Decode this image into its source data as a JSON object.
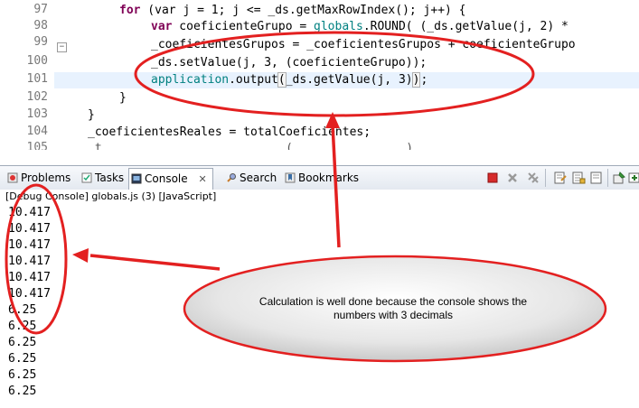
{
  "editor": {
    "line_numbers": [
      "97",
      "98",
      "99",
      "100",
      "101",
      "102",
      "103",
      "104",
      "105"
    ],
    "lines": [
      {
        "kw": "for",
        "rest": " (var j = 1; j <= _ds.getMaxRowIndex(); j++) {"
      },
      {
        "kw": "var",
        "pre": " coeficienteGrupo = ",
        "glob": "globals",
        "post": ".ROUND( (_ds.getValue(j, 2) * "
      },
      {
        "text": "_coeficientesGrupos = _coeficientesGrupos + coeficienteGrupo"
      },
      {
        "text": "_ds.setValue(j, 3, (coeficienteGrupo));"
      },
      {
        "app": "application",
        "mid": ".output",
        "paren": "(",
        "args": "_ds.getValue(j, 3)",
        "close": ")",
        ";": ";"
      },
      {
        "text": "}"
      },
      {
        "text": "}"
      },
      {
        "text": "_coeficientesReales = totalCoeficientes;"
      },
      {
        "text": "_t        _  _ _ _ _ _ _ _  (  _ _ _  _ _ _ _)"
      }
    ]
  },
  "tabs": [
    {
      "label": "Problems",
      "icon": "problems-icon"
    },
    {
      "label": "Tasks",
      "icon": "tasks-icon"
    },
    {
      "label": "Console",
      "icon": "console-icon",
      "close": "✕"
    },
    {
      "label": "Search",
      "icon": "search-icon"
    },
    {
      "label": "Bookmarks",
      "icon": "bookmarks-icon"
    }
  ],
  "console": {
    "header": "[Debug Console] globals.js (3) [JavaScript]",
    "output": [
      "10.417",
      "10.417",
      "10.417",
      "10.417",
      "10.417",
      "10.417",
      "6.25",
      "6.25",
      "6.25",
      "6.25",
      "6.25",
      "6.25"
    ]
  },
  "annotation": {
    "callout_line1": "Calculation is well done because the console shows the",
    "callout_line2": "numbers with 3 decimals",
    "color": "#e32020"
  }
}
